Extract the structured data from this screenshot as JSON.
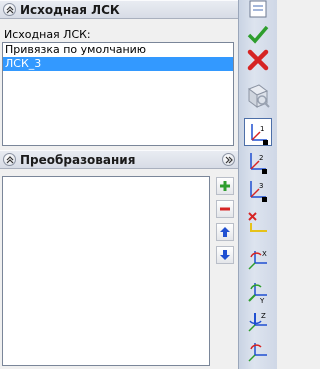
{
  "source_lcs": {
    "header_title": "Исходная ЛСК",
    "field_label": "Исходная ЛСК:",
    "items": [
      "Привязка по умолчанию",
      "ЛСК_3"
    ],
    "selected_index": 1
  },
  "transforms": {
    "header_title": "Преобразования",
    "items": []
  },
  "colors": {
    "selection": "#3399ff",
    "header_bg": "#dde2ea",
    "add_green": "#2e9e2e",
    "remove_red": "#d62424",
    "arrow_blue": "#1f4fd1"
  },
  "toolbar_icons": [
    "properties-icon",
    "apply-check-icon",
    "cancel-x-icon",
    "zoom-preview-icon",
    "axis-1-icon",
    "axis-2-icon",
    "axis-3-icon",
    "delete-axis-icon",
    "rotate-x-icon",
    "rotate-y-icon",
    "rotate-z-icon",
    "rotate-xyz-icon"
  ]
}
